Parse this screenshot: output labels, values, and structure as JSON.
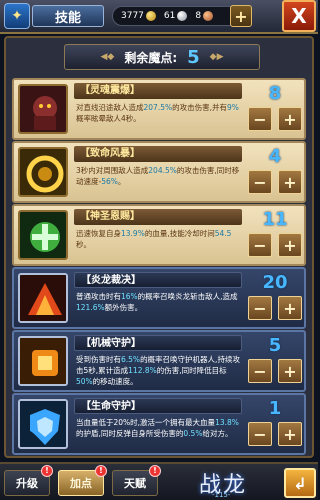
{
  "header": {
    "skill_icon": "skill-book-icon",
    "title": "技能",
    "gold": "3777",
    "silver": "61",
    "copper": "8",
    "add_label": "+",
    "close_label": "X"
  },
  "points": {
    "label": "剩余魔点:",
    "value": "5"
  },
  "skills": [
    {
      "name": "【灵魂震爆】",
      "icon": "soul-shock-icon",
      "style": "gold",
      "level": "8",
      "desc": [
        {
          "t": "对直线沿途敌人造成"
        },
        {
          "t": "207.5%",
          "h": true
        },
        {
          "t": "的攻击伤害,并有"
        },
        {
          "t": "9%",
          "h": true
        },
        {
          "t": "概率眩晕敌人4秒。"
        }
      ]
    },
    {
      "name": "【致命风暴】",
      "icon": "deadly-storm-icon",
      "style": "gold",
      "level": "4",
      "desc": [
        {
          "t": "3秒内对周围敌人造成"
        },
        {
          "t": "204.5%",
          "h": true
        },
        {
          "t": "的攻击伤害,同时移动速度-"
        },
        {
          "t": "56%",
          "h": true
        },
        {
          "t": "。"
        }
      ]
    },
    {
      "name": "【神圣恩赐】",
      "icon": "divine-grace-icon",
      "style": "gold",
      "level": "11",
      "desc": [
        {
          "t": "迅速恢复自身"
        },
        {
          "t": "13.9%",
          "h": true
        },
        {
          "t": "的血量,技能冷却时间"
        },
        {
          "t": "54.5",
          "h": true
        },
        {
          "t": "秒。"
        }
      ]
    },
    {
      "name": "【炎龙裁决】",
      "icon": "flame-dragon-icon",
      "style": "blue",
      "level": "20",
      "desc": [
        {
          "t": "普通攻击时有"
        },
        {
          "t": "16%",
          "h": true
        },
        {
          "t": "的概率召唤炎龙斩击敌人,造成"
        },
        {
          "t": "121.6%",
          "h": true
        },
        {
          "t": "额外伤害。"
        }
      ]
    },
    {
      "name": "【机械守护】",
      "icon": "mech-guard-icon",
      "style": "blue",
      "level": "5",
      "desc": [
        {
          "t": "受到伤害时有"
        },
        {
          "t": "6.5%",
          "h": true
        },
        {
          "t": "的概率召唤守护机器人,持续攻击5秒,累计造成"
        },
        {
          "t": "112.8%",
          "h": true
        },
        {
          "t": "的伤害,同时降低目标"
        },
        {
          "t": "50%",
          "h": true
        },
        {
          "t": "的移动速度。"
        }
      ]
    },
    {
      "name": "【生命守护】",
      "icon": "life-guard-icon",
      "style": "blue",
      "level": "1",
      "desc": [
        {
          "t": "当血量低于20%时,激活一个拥有最大血量"
        },
        {
          "t": "13.8%",
          "h": true
        },
        {
          "t": "的护盾,同时反弹自身所受伤害的"
        },
        {
          "t": "0.5%",
          "h": true
        },
        {
          "t": "给对方。"
        }
      ]
    }
  ],
  "minus_label": "−",
  "plus_label": "+",
  "tabs": [
    {
      "label": "升级",
      "badge": "!"
    },
    {
      "label": "加点",
      "badge": "!"
    },
    {
      "label": "天赋",
      "badge": "!"
    }
  ],
  "logo": {
    "title": "战龙",
    "sub": "-115-"
  },
  "confirm_label": "↲"
}
